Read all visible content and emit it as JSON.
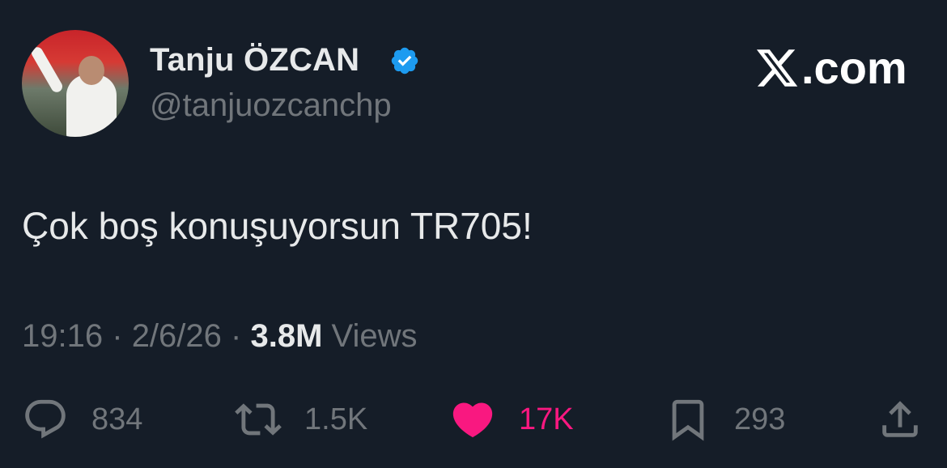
{
  "author": {
    "display_name": "Tanju ÖZCAN",
    "handle": "@tanjuozcanchp",
    "verified": true
  },
  "brand": {
    "text": ".com",
    "icon": "x-logo-icon"
  },
  "tweet": {
    "text": "Çok boş konuşuyorsun TR705!"
  },
  "meta": {
    "time": "19:16",
    "separator": "·",
    "date": "2/6/26",
    "views_count": "3.8M",
    "views_label": "Views"
  },
  "actions": {
    "reply": {
      "icon": "reply-icon",
      "count": "834"
    },
    "retweet": {
      "icon": "retweet-icon",
      "count": "1.5K"
    },
    "like": {
      "icon": "heart-icon",
      "count": "17K",
      "active": true,
      "color": "#f91880"
    },
    "bookmark": {
      "icon": "bookmark-icon",
      "count": "293"
    },
    "share": {
      "icon": "share-icon"
    }
  },
  "colors": {
    "background": "#151d28",
    "primary_text": "#e7e9ea",
    "secondary_text": "#71767b",
    "verified_badge": "#1d9bf0",
    "like_active": "#f91880"
  }
}
